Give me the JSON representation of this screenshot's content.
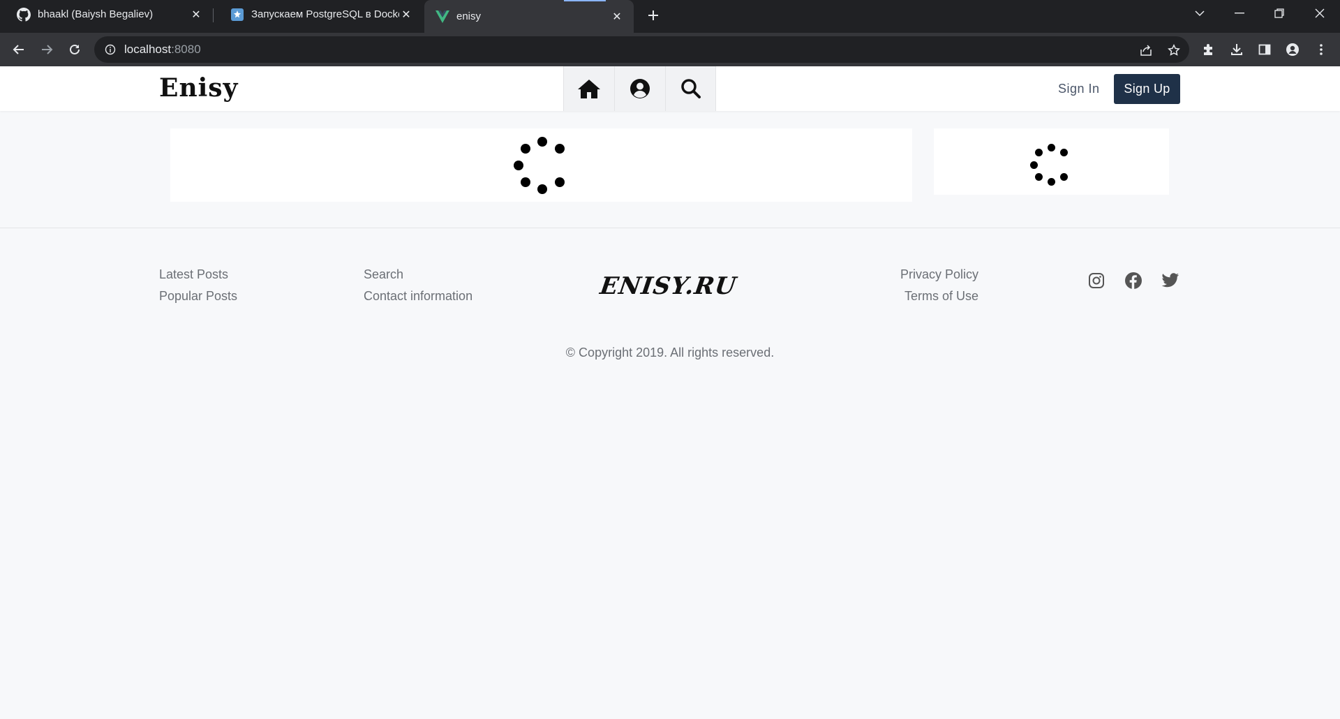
{
  "browser": {
    "tabs": [
      {
        "title": "bhaakl (Baiysh Begaliev)",
        "icon": "github-icon"
      },
      {
        "title": "Запускаем PostgreSQL в Docker",
        "icon": "habr-icon"
      },
      {
        "title": "enisy",
        "icon": "vue-icon",
        "active": true
      }
    ],
    "url_host": "localhost",
    "url_port": ":8080"
  },
  "header": {
    "logo": "Enisy",
    "nav_icons": [
      "home-icon",
      "user-circle-icon",
      "search-icon"
    ],
    "signin_label": "Sign In",
    "signup_label": "Sign Up",
    "signup_color": "#1f3148"
  },
  "footer": {
    "col1": [
      "Latest Posts",
      "Popular Posts"
    ],
    "col2": [
      "Search",
      "Contact information"
    ],
    "logo": "ENISY.RU",
    "col3": [
      "Privacy Policy",
      "Terms of Use"
    ],
    "social": [
      "instagram-icon",
      "facebook-icon",
      "twitter-icon"
    ],
    "copyright": "© Copyright 2019. All rights reserved."
  }
}
